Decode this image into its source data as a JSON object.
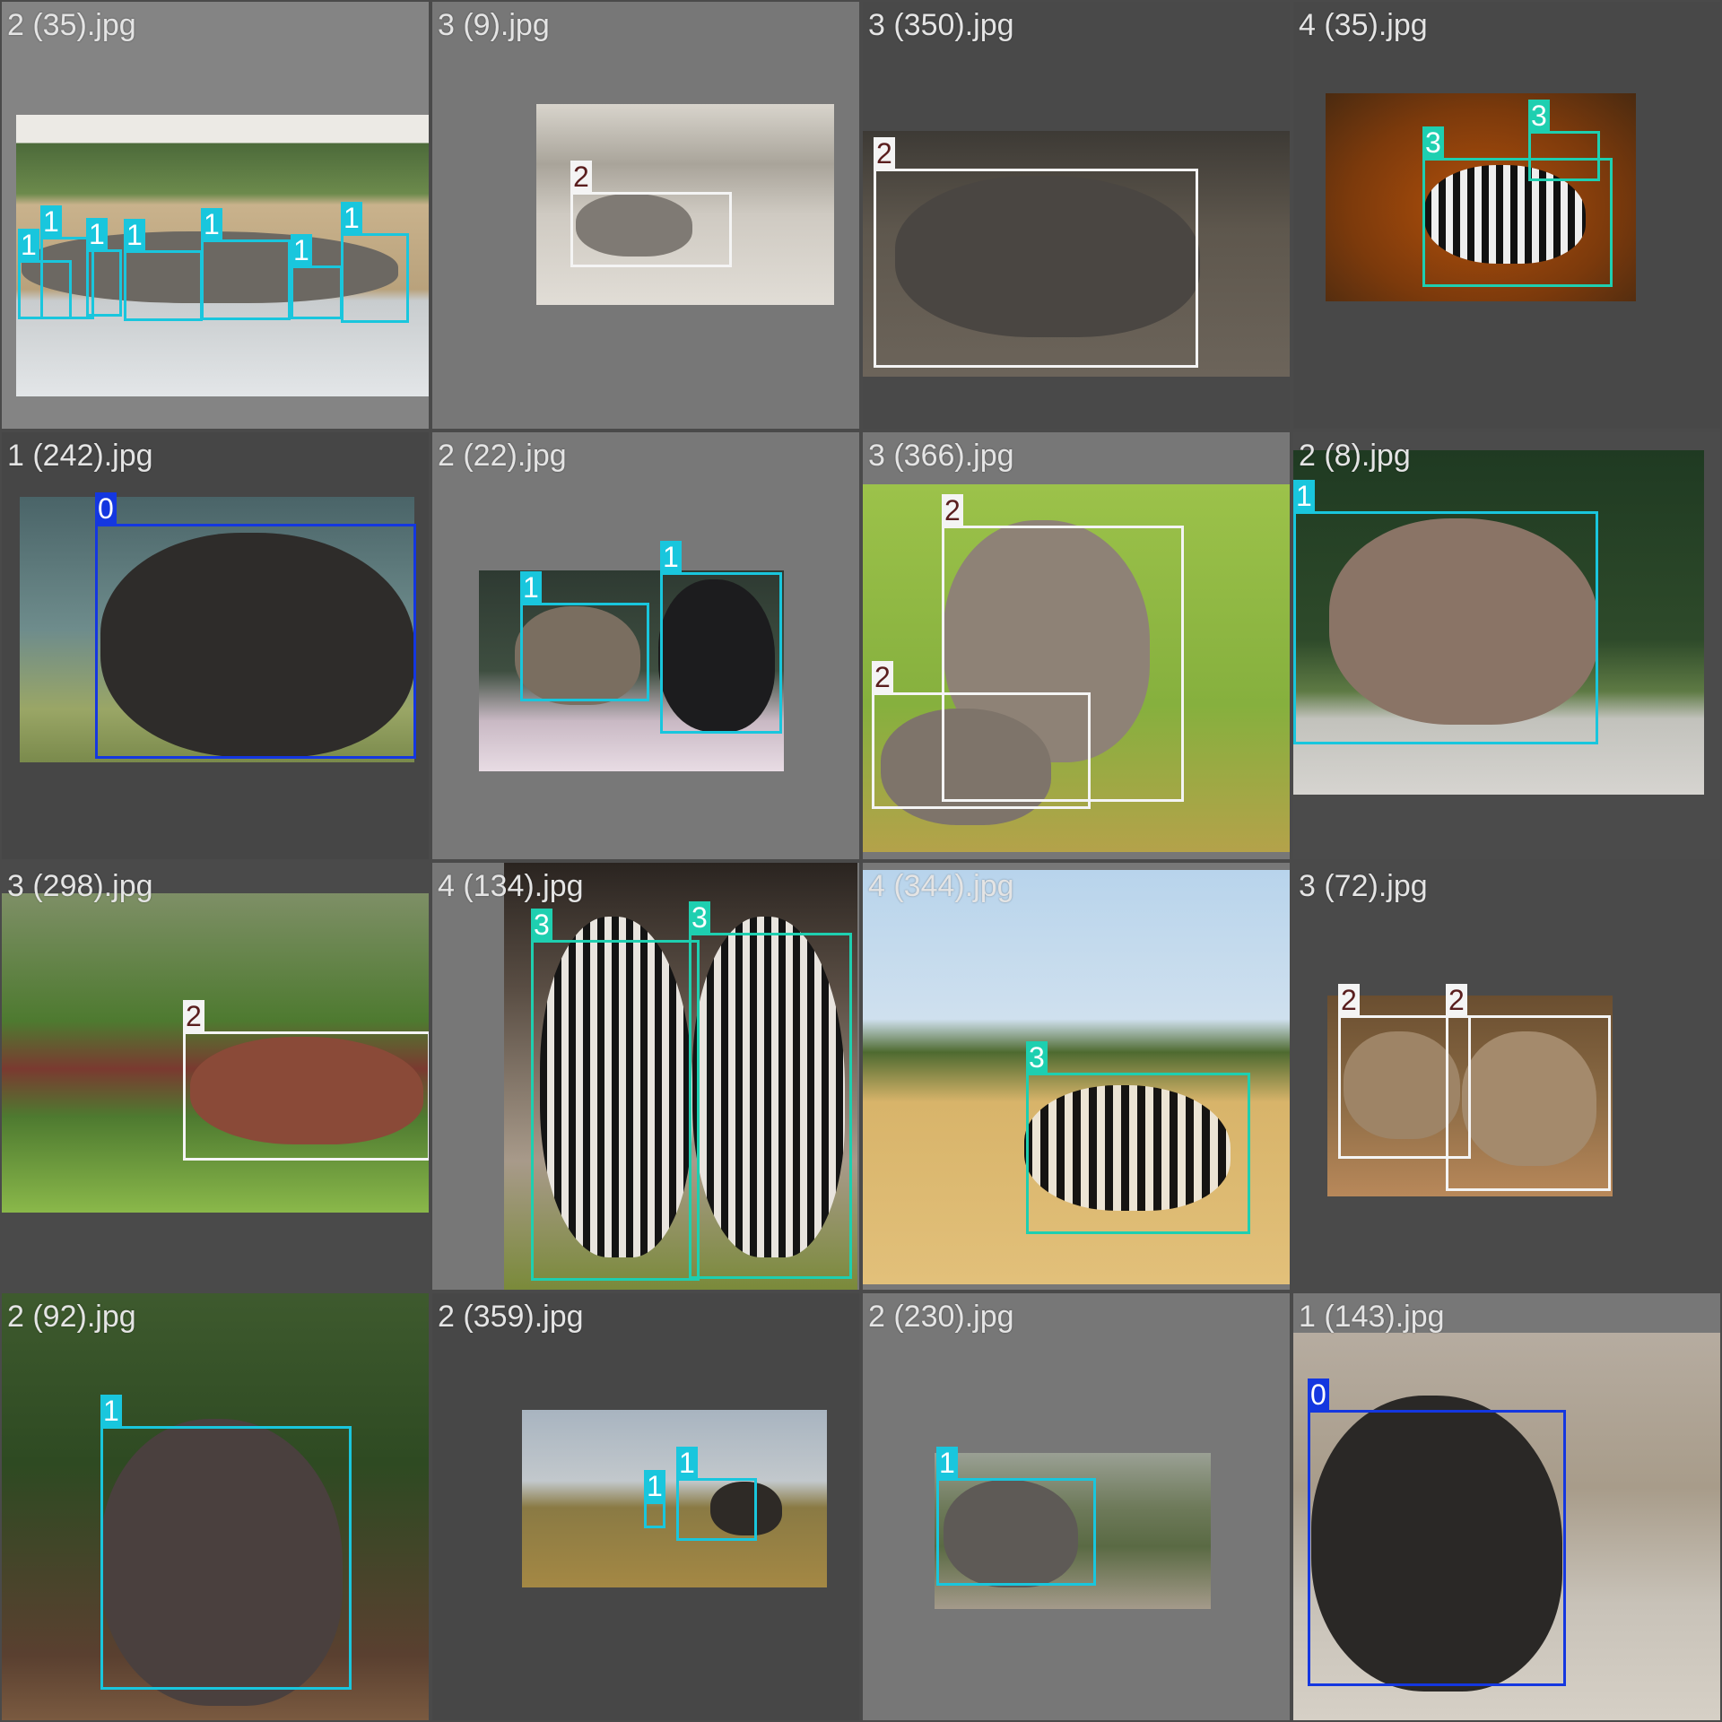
{
  "grid": {
    "background_color": "#4a4a4a",
    "class_colors": {
      "0": {
        "box": "#1437e0",
        "label_bg": "#1437e0",
        "label_text": "#ffffff"
      },
      "1": {
        "box": "#19c6dd",
        "label_bg": "#19c6dd",
        "label_text": "#ffffff"
      },
      "2": {
        "box": "#f4f4f4",
        "label_bg": "#f4f4f4",
        "label_text": "#5a1e1e"
      },
      "3": {
        "box": "#1ecfb0",
        "label_bg": "#1ecfb0",
        "label_text": "#ffffff"
      }
    },
    "tiles": [
      {
        "title": "2 (35).jpg",
        "boxes": [
          {
            "label": "1"
          },
          {
            "label": "1"
          },
          {
            "label": "1"
          },
          {
            "label": "1"
          },
          {
            "label": "1"
          },
          {
            "label": "1"
          },
          {
            "label": "1"
          }
        ]
      },
      {
        "title": "3 (9).jpg",
        "boxes": [
          {
            "label": "2"
          }
        ]
      },
      {
        "title": "3 (350).jpg",
        "boxes": [
          {
            "label": "2"
          }
        ]
      },
      {
        "title": "4 (35).jpg",
        "boxes": [
          {
            "label": "3"
          },
          {
            "label": "3"
          }
        ]
      },
      {
        "title": "1 (242).jpg",
        "boxes": [
          {
            "label": "0"
          }
        ]
      },
      {
        "title": "2 (22).jpg",
        "boxes": [
          {
            "label": "1"
          },
          {
            "label": "1"
          }
        ]
      },
      {
        "title": "3 (366).jpg",
        "boxes": [
          {
            "label": "2"
          },
          {
            "label": "2"
          }
        ]
      },
      {
        "title": "2 (8).jpg",
        "boxes": [
          {
            "label": "1"
          }
        ]
      },
      {
        "title": "3 (298).jpg",
        "boxes": [
          {
            "label": "2"
          }
        ]
      },
      {
        "title": "4 (134).jpg",
        "boxes": [
          {
            "label": "3"
          },
          {
            "label": "3"
          }
        ]
      },
      {
        "title": "4 (344).jpg",
        "boxes": [
          {
            "label": "3"
          }
        ]
      },
      {
        "title": "3 (72).jpg",
        "boxes": [
          {
            "label": "2"
          },
          {
            "label": "2"
          }
        ]
      },
      {
        "title": "2 (92).jpg",
        "boxes": [
          {
            "label": "1"
          }
        ]
      },
      {
        "title": "2 (359).jpg",
        "boxes": [
          {
            "label": "1"
          },
          {
            "label": "1"
          }
        ]
      },
      {
        "title": "2 (230).jpg",
        "boxes": [
          {
            "label": "1"
          }
        ]
      },
      {
        "title": "1 (143).jpg",
        "boxes": [
          {
            "label": "0"
          }
        ]
      }
    ]
  }
}
